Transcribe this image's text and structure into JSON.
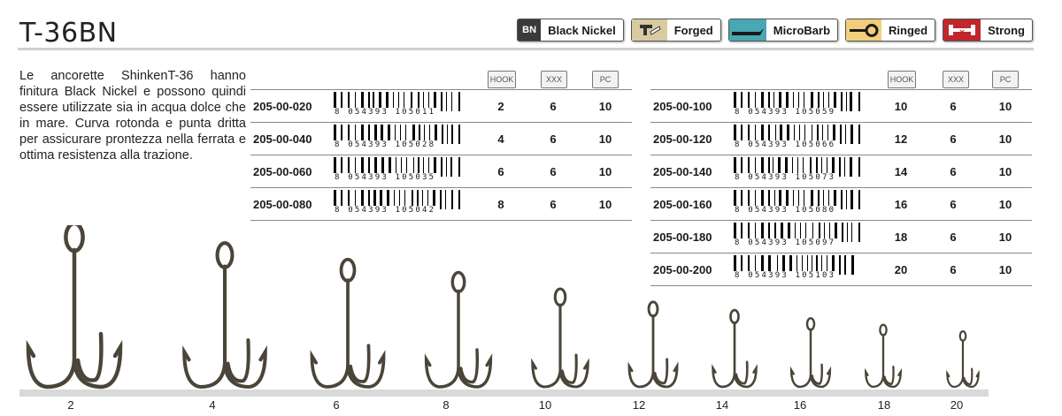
{
  "title": "T-36BN",
  "badges": [
    {
      "icon_text": "BN",
      "label": "Black Nickel",
      "color": "#3a3a3a"
    },
    {
      "icon_text": "",
      "label": "Forged",
      "color": "#d8cba0"
    },
    {
      "icon_text": "",
      "label": "MicroBarb",
      "color": "#48a8b4"
    },
    {
      "icon_text": "",
      "label": "Ringed",
      "color": "#f1cf7a"
    },
    {
      "icon_text": "",
      "label": "Strong",
      "color": "#c0262b"
    }
  ],
  "description": "Le ancorette ShinkenT-36 hanno finitura Black Nickel e possono quindi essere utilizzate sia in acqua dolce che in mare. Curva rotonda e punta dritta per assicurare prontezza nella ferrata e ottima resistenza alla trazione.",
  "table_headers": {
    "hook": "HOOK",
    "box": "XXX",
    "pcs": "PC"
  },
  "table_left": [
    {
      "code": "205-00-020",
      "ean": "8 054393 105011",
      "hook": "2",
      "box": "6",
      "pcs": "10"
    },
    {
      "code": "205-00-040",
      "ean": "8 054393 105028",
      "hook": "4",
      "box": "6",
      "pcs": "10"
    },
    {
      "code": "205-00-060",
      "ean": "8 054393 105035",
      "hook": "6",
      "box": "6",
      "pcs": "10"
    },
    {
      "code": "205-00-080",
      "ean": "8 054393 105042",
      "hook": "8",
      "box": "6",
      "pcs": "10"
    }
  ],
  "table_right": [
    {
      "code": "205-00-100",
      "ean": "8 054393 105059",
      "hook": "10",
      "box": "6",
      "pcs": "10"
    },
    {
      "code": "205-00-120",
      "ean": "8 054393 105066",
      "hook": "12",
      "box": "6",
      "pcs": "10"
    },
    {
      "code": "205-00-140",
      "ean": "8 054393 105073",
      "hook": "14",
      "box": "6",
      "pcs": "10"
    },
    {
      "code": "205-00-160",
      "ean": "8 054393 105080",
      "hook": "16",
      "box": "6",
      "pcs": "10"
    },
    {
      "code": "205-00-180",
      "ean": "8 054393 105097",
      "hook": "18",
      "box": "6",
      "pcs": "10"
    },
    {
      "code": "205-00-200",
      "ean": "8 054393 105103",
      "hook": "20",
      "box": "6",
      "pcs": "10"
    }
  ],
  "hook_sizes": [
    "2",
    "4",
    "6",
    "8",
    "10",
    "12",
    "14",
    "16",
    "18",
    "20"
  ]
}
